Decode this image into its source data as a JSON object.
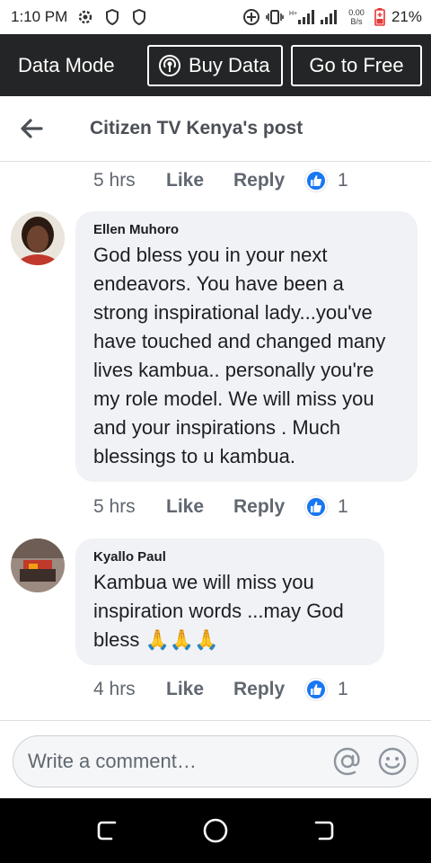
{
  "status_bar": {
    "time": "1:10 PM",
    "net_speed_value": "0.00",
    "net_speed_unit": "B/s",
    "battery": "21%"
  },
  "data_bar": {
    "mode_label": "Data Mode",
    "buy_label": "Buy Data",
    "free_label": "Go to Free"
  },
  "header": {
    "title": "Citizen TV Kenya's post"
  },
  "first_meta": {
    "time": "5 hrs",
    "like": "Like",
    "reply": "Reply",
    "reactions": "1"
  },
  "comments": [
    {
      "author": "Ellen Muhoro",
      "text": "God bless you in your next endeavors. You have been a strong inspirational lady...you've have touched and changed many lives kambua.. personally you're my role model. We will miss you and your inspirations . Much blessings to u kambua.",
      "time": "5 hrs",
      "like": "Like",
      "reply": "Reply",
      "reactions": "1"
    },
    {
      "author": "Kyallo Paul",
      "text": "Kambua we will miss you inspiration words ...may God bless 🙏🙏🙏",
      "time": "4 hrs",
      "like": "Like",
      "reply": "Reply",
      "reactions": "1"
    }
  ],
  "composer": {
    "placeholder": "Write a comment…"
  },
  "colors": {
    "data_bar_bg": "#242526",
    "like_blue": "#1877f2",
    "bubble_bg": "#f0f2f5",
    "battery_red": "#e53935"
  }
}
